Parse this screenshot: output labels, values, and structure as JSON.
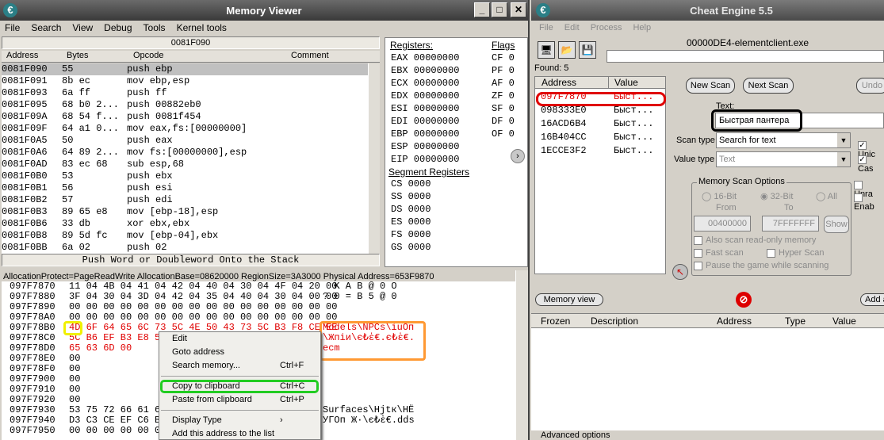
{
  "mv": {
    "title": "Memory Viewer",
    "menu": [
      "File",
      "Search",
      "View",
      "Debug",
      "Tools",
      "Kernel tools"
    ],
    "address_bar": "0081F090",
    "cols": {
      "address": "Address",
      "bytes": "Bytes",
      "opcode": "Opcode",
      "comment": "Comment"
    },
    "disasm": [
      {
        "a": "0081F090",
        "b": "55",
        "o": "push ebp"
      },
      {
        "a": "0081F091",
        "b": "8b ec",
        "o": "mov ebp,esp"
      },
      {
        "a": "0081F093",
        "b": "6a ff",
        "o": "push ff"
      },
      {
        "a": "0081F095",
        "b": "68 b0 2...",
        "o": "push 00882eb0"
      },
      {
        "a": "0081F09A",
        "b": "68 54 f...",
        "o": "push 0081f454"
      },
      {
        "a": "0081F09F",
        "b": "64 a1 0...",
        "o": "mov eax,fs:[00000000]"
      },
      {
        "a": "0081F0A5",
        "b": "50",
        "o": "push eax"
      },
      {
        "a": "0081F0A6",
        "b": "64 89 2...",
        "o": "mov fs:[00000000],esp"
      },
      {
        "a": "0081F0AD",
        "b": "83 ec 68",
        "o": "sub esp,68"
      },
      {
        "a": "0081F0B0",
        "b": "53",
        "o": "push ebx"
      },
      {
        "a": "0081F0B1",
        "b": "56",
        "o": "push esi"
      },
      {
        "a": "0081F0B2",
        "b": "57",
        "o": "push edi"
      },
      {
        "a": "0081F0B3",
        "b": "89 65 e8",
        "o": "mov [ebp-18],esp"
      },
      {
        "a": "0081F0B6",
        "b": "33 db",
        "o": "xor ebx,ebx"
      },
      {
        "a": "0081F0B8",
        "b": "89 5d fc",
        "o": "mov [ebp-04],ebx"
      },
      {
        "a": "0081F0BB",
        "b": "6a 02",
        "o": "push 02"
      }
    ],
    "status": "Push Word or Doubleword Onto the Stack",
    "registers_label": "Registers:",
    "flags_label": "Flags",
    "registers": [
      "EAX 00000000",
      "EBX 00000000",
      "ECX 00000000",
      "EDX 00000000",
      "ESI 00000000",
      "EDI 00000000",
      "EBP 00000000",
      "ESP 00000000",
      "EIP 00000000"
    ],
    "flags": [
      "CF 0",
      "PF 0",
      "AF 0",
      "ZF 0",
      "SF 0",
      "DF 0",
      "OF 0"
    ],
    "segment_label": "Segment Registers",
    "segments": [
      "CS 0000",
      "SS 0000",
      "DS 0000",
      "ES 0000",
      "FS 0000",
      "GS 0000"
    ],
    "hex_info": "AllocationProtect=PageReadWrite AllocationBase=08620000 RegionSize=3A3000 Physical Address=653F9870",
    "hex": [
      {
        "a": "097F7870",
        "h": "11 04 4B 04 41 04 42 04 40 04 30 04 4F 04 20 00",
        "t": "  K A B @ 0 O"
      },
      {
        "a": "097F7880",
        "h": "3F 04 30 04 3D 04 42 04 35 04 40 04 30 04 00 00",
        "t": "? 0 = B 5 @ 0"
      },
      {
        "a": "097F7890",
        "h": "00 00 00 00 00 00 00 00 00 00 00 00 00 00 00 00",
        "t": ""
      },
      {
        "a": "097F78A0",
        "h": "00 00 00 00 00 00 00 00 00 00 00 00 00 00 00 00",
        "t": ""
      },
      {
        "a": "097F78B0",
        "h": "4D 6F 64 65 6C 73 5C 4E 50 43 73 5C B3 F8 CE EE",
        "t": "Models\\NPCs\\іuОп"
      },
      {
        "a": "097F78C0",
        "h": "5C B6 EF B3 E8 50 ..",
        "t": "\\Жпіи\\є₺ἑ€.є₺ἑ€."
      },
      {
        "a": "097F78D0",
        "h": "65 63 6D 00",
        "t": "ecm"
      },
      {
        "a": "097F78E0",
        "h": "00",
        "t": ""
      },
      {
        "a": "097F78F0",
        "h": "00",
        "t": ""
      },
      {
        "a": "097F7900",
        "h": "00",
        "t": ""
      },
      {
        "a": "097F7910",
        "h": "00",
        "t": ""
      },
      {
        "a": "097F7920",
        "h": "00",
        "t": ""
      },
      {
        "a": "097F7930",
        "h": "53 75 72 66 61 63",
        "t": "Surfaces\\Hjtк\\HЁ"
      },
      {
        "a": "097F7940",
        "h": "D3 C3 CE EF C6 B7",
        "t": "УГОп Ж·\\є₺ἑ€.dds"
      },
      {
        "a": "097F7950",
        "h": "00 00 00 00 00 00",
        "t": ""
      }
    ],
    "context_menu": [
      {
        "label": "Edit",
        "shortcut": ""
      },
      {
        "label": "Goto address",
        "shortcut": ""
      },
      {
        "label": "Search memory...",
        "shortcut": "Ctrl+F"
      },
      {
        "label": "Copy to clipboard",
        "shortcut": "Ctrl+C"
      },
      {
        "label": "Paste from clipboard",
        "shortcut": "Ctrl+P"
      },
      {
        "label": "Display Type",
        "shortcut": "›"
      },
      {
        "label": "Add this address to the list",
        "shortcut": ""
      }
    ]
  },
  "ce": {
    "title": "Cheat Engine 5.5",
    "menu": [
      "File",
      "Edit",
      "Process",
      "Help"
    ],
    "process": "00000DE4-elementclient.exe",
    "found": "Found: 5",
    "cols": {
      "address": "Address",
      "value": "Value"
    },
    "results": [
      {
        "a": "097F7870",
        "v": "Быст..."
      },
      {
        "a": "098333E0",
        "v": "Быст..."
      },
      {
        "a": "16ACD6B4",
        "v": "Быст..."
      },
      {
        "a": "16B404CC",
        "v": "Быст..."
      },
      {
        "a": "1ECCE3F2",
        "v": "Быст..."
      }
    ],
    "new_scan": "New Scan",
    "next_scan": "Next Scan",
    "undo_scan": "Undo",
    "text_label": "Text:",
    "text_value": "Быстрая пантера",
    "scan_type_label": "Scan type",
    "scan_type": "Search for text",
    "value_type_label": "Value type",
    "value_type": "Text",
    "unicode": "Unic",
    "case": "Cas",
    "unrandomizer": "Unra",
    "enable": "Enab",
    "options_title": "Memory Scan Options",
    "bit16": "16-Bit",
    "bit32": "32-Bit",
    "all": "All",
    "from": "From",
    "to": "To",
    "from_value": "00400000",
    "to_value": "7FFFFFFF",
    "show": "Show",
    "readonly": "Also scan read-only memory",
    "fast": "Fast scan",
    "hyper": "Hyper Scan",
    "pause": "Pause the game while scanning",
    "memory_view": "Memory view",
    "add_address": "Add a",
    "table_cols": {
      "frozen": "Frozen",
      "description": "Description",
      "address": "Address",
      "type": "Type",
      "value": "Value"
    },
    "advanced": "Advanced options"
  },
  "colors": {
    "red": "#e00000",
    "yellow": "#f0f000",
    "orange": "#ff9933",
    "green": "#22cc22",
    "black": "#000000"
  }
}
